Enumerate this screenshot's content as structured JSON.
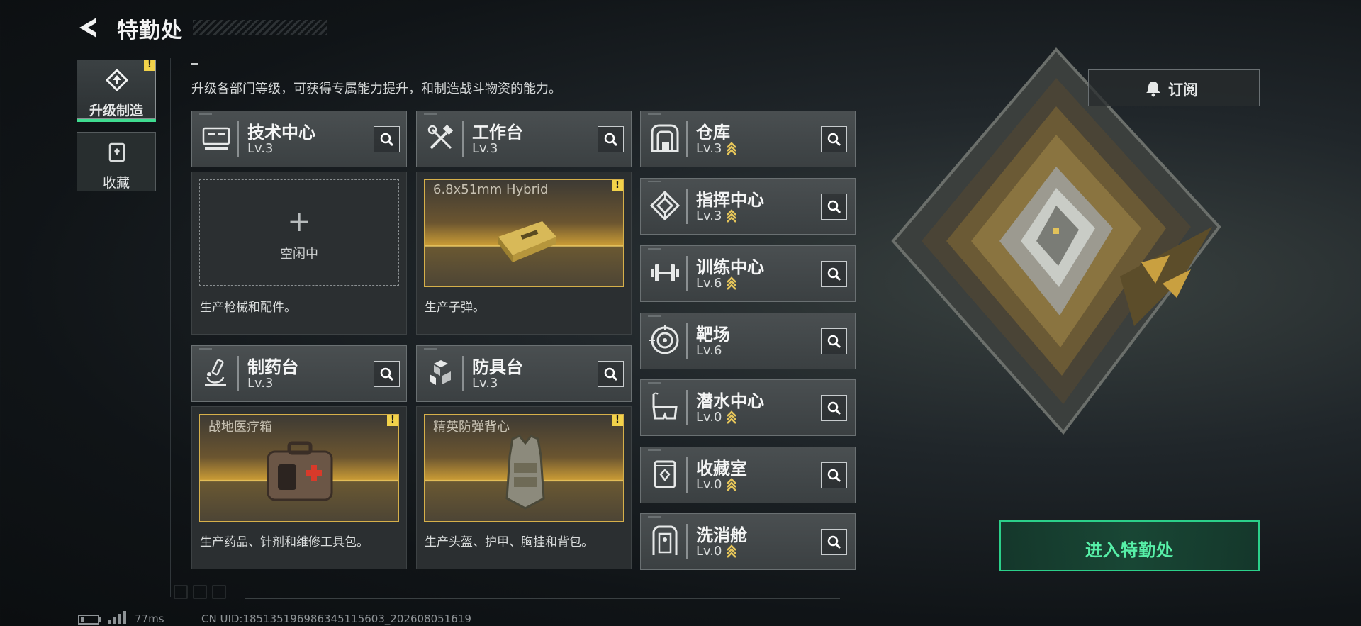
{
  "header": {
    "title": "特勤处"
  },
  "sidebar": {
    "tabs": [
      {
        "label": "升级制造",
        "active": true,
        "warning": "!"
      },
      {
        "label": "收藏",
        "active": false
      }
    ]
  },
  "description": "升级各部门等级，可获得专属能力提升，和制造战斗物资的能力。",
  "subscribe": {
    "label": "订阅"
  },
  "big_cards": [
    {
      "name": "技术中心",
      "level": "Lv.3",
      "product": "",
      "idle_label": "空闲中",
      "desc": "生产枪械和配件。",
      "icon": "tech-center-icon"
    },
    {
      "name": "工作台",
      "level": "Lv.3",
      "product": "6.8x51mm Hybrid",
      "warning": "!",
      "desc": "生产子弹。",
      "icon": "workbench-icon"
    },
    {
      "name": "制药台",
      "level": "Lv.3",
      "product": "战地医疗箱",
      "warning": "!",
      "desc": "生产药品、针剂和维修工具包。",
      "icon": "pharmacy-icon"
    },
    {
      "name": "防具台",
      "level": "Lv.3",
      "product": "精英防弹背心",
      "warning": "!",
      "desc": "生产头盔、护甲、胸挂和背包。",
      "icon": "armor-bench-icon"
    }
  ],
  "small_cards": [
    {
      "name": "仓库",
      "level": "Lv.3",
      "upgradable": true,
      "icon": "warehouse-icon"
    },
    {
      "name": "指挥中心",
      "level": "Lv.3",
      "upgradable": true,
      "icon": "command-center-icon"
    },
    {
      "name": "训练中心",
      "level": "Lv.6",
      "upgradable": true,
      "icon": "training-center-icon"
    },
    {
      "name": "靶场",
      "level": "Lv.6",
      "upgradable": false,
      "icon": "shooting-range-icon"
    },
    {
      "name": "潜水中心",
      "level": "Lv.0",
      "upgradable": true,
      "icon": "diving-center-icon"
    },
    {
      "name": "收藏室",
      "level": "Lv.0",
      "upgradable": true,
      "icon": "collection-room-icon"
    },
    {
      "name": "洗消舱",
      "level": "Lv.0",
      "upgradable": true,
      "icon": "decon-chamber-icon"
    }
  ],
  "enter_button": {
    "label": "进入特勤处"
  },
  "status": {
    "ping": "77ms",
    "uid": "CN UID:185135196986345115603_202608051619"
  },
  "colors": {
    "accent_green": "#3fdc90",
    "warning_yellow": "#f2d24a",
    "gold": "#d6b04a"
  }
}
